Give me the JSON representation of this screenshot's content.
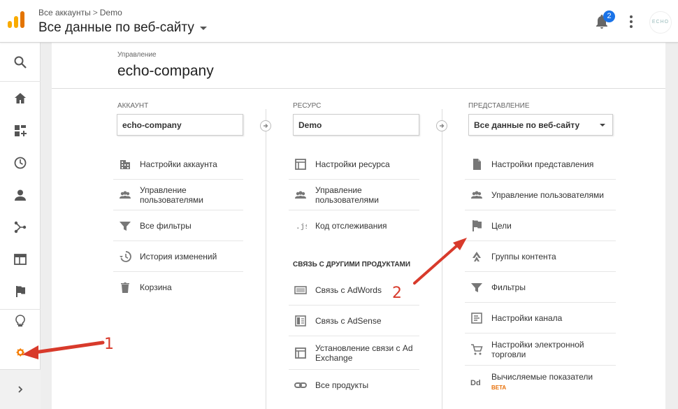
{
  "header": {
    "breadcrumb": [
      "Все аккаунты",
      "Demo"
    ],
    "breadcrumb_sep": ">",
    "view_title": "Все данные по веб-сайту",
    "notification_count": "2",
    "avatar_text": "ECHO"
  },
  "rail": {
    "items": [
      {
        "name": "search-icon"
      },
      {
        "name": "home-icon"
      },
      {
        "name": "customization-icon"
      },
      {
        "name": "realtime-icon"
      },
      {
        "name": "audience-icon"
      },
      {
        "name": "acquisition-icon"
      },
      {
        "name": "behavior-icon"
      },
      {
        "name": "conversions-icon"
      },
      {
        "name": "discover-icon"
      },
      {
        "name": "admin-gear-icon"
      }
    ],
    "expand": "expand-icon"
  },
  "admin": {
    "label": "Управление",
    "account_name": "echo-company",
    "columns": {
      "account": {
        "heading": "АККАУНТ",
        "selector": "echo-company",
        "items": [
          {
            "label": "Настройки аккаунта",
            "icon": "building-icon"
          },
          {
            "label": "Управление пользователями",
            "icon": "users-icon"
          },
          {
            "label": "Все фильтры",
            "icon": "filter-icon"
          },
          {
            "label": "История изменений",
            "icon": "history-icon"
          },
          {
            "label": "Корзина",
            "icon": "trash-icon"
          }
        ]
      },
      "property": {
        "heading": "РЕСУРС",
        "selector": "Demo",
        "items": [
          {
            "label": "Настройки ресурса",
            "icon": "property-settings-icon"
          },
          {
            "label": "Управление пользователями",
            "icon": "users-icon"
          },
          {
            "label": "Код отслеживания",
            "icon": "js-icon"
          }
        ],
        "links_heading": "СВЯЗЬ С ДРУГИМИ ПРОДУКТАМИ",
        "links": [
          {
            "label": "Связь с AdWords",
            "icon": "adwords-icon"
          },
          {
            "label": "Связь с AdSense",
            "icon": "adsense-icon"
          },
          {
            "label": "Установление связи с Ad Exchange",
            "icon": "adexchange-icon"
          },
          {
            "label": "Все продукты",
            "icon": "link-icon"
          }
        ]
      },
      "view": {
        "heading": "ПРЕДСТАВЛЕНИЕ",
        "selector": "Все данные по веб-сайту",
        "items": [
          {
            "label": "Настройки представления",
            "icon": "document-icon"
          },
          {
            "label": "Управление пользователями",
            "icon": "users-icon"
          },
          {
            "label": "Цели",
            "icon": "flag-icon"
          },
          {
            "label": "Группы контента",
            "icon": "content-group-icon"
          },
          {
            "label": "Фильтры",
            "icon": "filter-icon"
          },
          {
            "label": "Настройки канала",
            "icon": "channel-icon"
          },
          {
            "label": "Настройки электронной торговли",
            "icon": "cart-icon"
          },
          {
            "label": "Вычисляемые показатели",
            "icon": "dd-icon",
            "sub": "BETA"
          }
        ]
      }
    }
  },
  "annotations": [
    "1",
    "2"
  ],
  "colors": {
    "accent": "#f57c00",
    "annotation": "#d83a2b",
    "badge": "#1a73e8"
  }
}
